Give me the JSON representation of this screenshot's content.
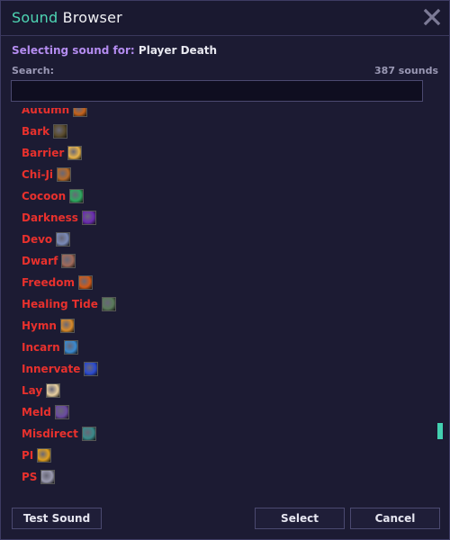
{
  "window": {
    "title_accent": "Sound",
    "title_rest": " Browser",
    "subtitle_label": "Selecting sound for: ",
    "subtitle_value": "Player Death",
    "search_label": "Search:",
    "sound_count": "387 sounds",
    "search_value": ""
  },
  "sounds": [
    {
      "label": "Autumn",
      "icon": "autumn-icon",
      "color": "#c4621a"
    },
    {
      "label": "Bark",
      "icon": "bark-icon",
      "color": "#5a4b2c"
    },
    {
      "label": "Barrier",
      "icon": "barrier-icon",
      "color": "#e6b24a"
    },
    {
      "label": "Chi-Ji",
      "icon": "chi-ji-icon",
      "color": "#b66b2a"
    },
    {
      "label": "Cocoon",
      "icon": "cocoon-icon",
      "color": "#2fa860"
    },
    {
      "label": "Darkness",
      "icon": "darkness-icon",
      "color": "#6a2bb0"
    },
    {
      "label": "Devo",
      "icon": "devo-icon",
      "color": "#7a8ab8"
    },
    {
      "label": "Dwarf",
      "icon": "dwarf-icon",
      "color": "#a06a5a"
    },
    {
      "label": "Freedom",
      "icon": "freedom-icon",
      "color": "#d05a18"
    },
    {
      "label": "Healing Tide",
      "icon": "healing-tide-icon",
      "color": "#5a7a5a"
    },
    {
      "label": "Hymn",
      "icon": "hymn-icon",
      "color": "#d88a2a"
    },
    {
      "label": "Incarn",
      "icon": "incarn-icon",
      "color": "#3a8ad0"
    },
    {
      "label": "Innervate",
      "icon": "innervate-icon",
      "color": "#2a4ad0"
    },
    {
      "label": "Lay",
      "icon": "lay-icon",
      "color": "#e8d0a0"
    },
    {
      "label": "Meld",
      "icon": "meld-icon",
      "color": "#6a4aa0"
    },
    {
      "label": "Misdirect",
      "icon": "misdirect-icon",
      "color": "#3a8a8a"
    },
    {
      "label": "PI",
      "icon": "pi-icon",
      "color": "#e0a020"
    },
    {
      "label": "PS",
      "icon": "ps-icon",
      "color": "#9a9ab0"
    }
  ],
  "buttons": {
    "test": "Test Sound",
    "select": "Select",
    "cancel": "Cancel"
  },
  "scrollbar": {
    "position_fraction": 0.85
  }
}
